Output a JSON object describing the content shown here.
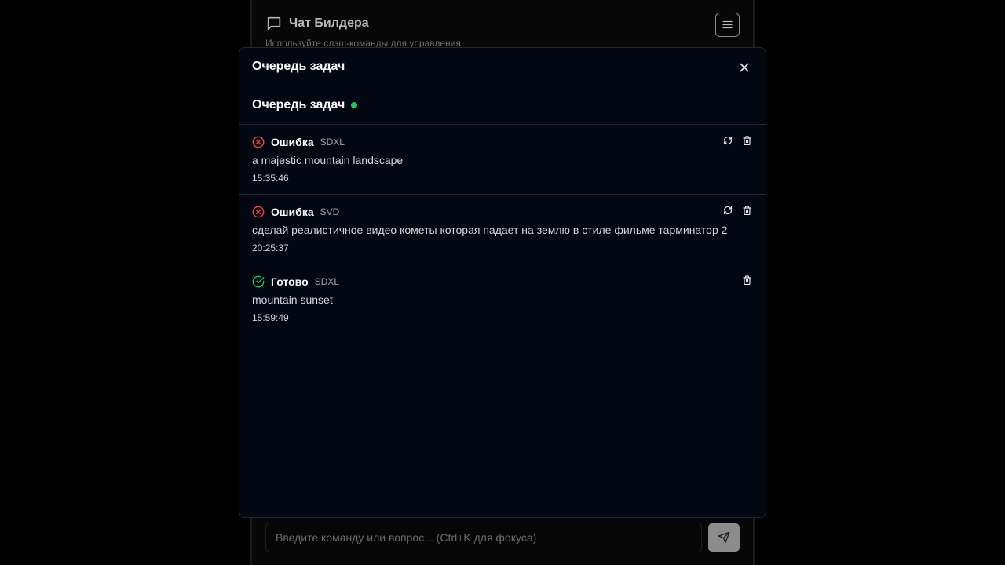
{
  "app": {
    "title": "Чат Билдера",
    "subtitle": "Используйте слэш-команды для управления",
    "composer_placeholder": "Введите команду или вопрос... (Ctrl+K для фокуса)"
  },
  "modal": {
    "title": "Очередь задач",
    "queue_title": "Очередь задач",
    "queue_status_color": "#22c55e",
    "jobs": [
      {
        "status": "Ошибка",
        "status_icon": "x-circle-icon",
        "status_color": "#ef4444",
        "model": "SDXL",
        "prompt": "a majestic mountain landscape",
        "time": "15:35:46",
        "actions": [
          "retry-icon",
          "trash-icon"
        ]
      },
      {
        "status": "Ошибка",
        "status_icon": "x-circle-icon",
        "status_color": "#ef4444",
        "model": "SVD",
        "prompt": "сделай реалистичное видео кометы которая падает на землю в стиле фильме тарминатор 2",
        "time": "20:25:37",
        "actions": [
          "retry-icon",
          "trash-icon"
        ]
      },
      {
        "status": "Готово",
        "status_icon": "check-circle-icon",
        "status_color": "#22c55e",
        "model": "SDXL",
        "prompt": "mountain sunset",
        "time": "15:59:49",
        "actions": [
          "trash-icon"
        ]
      }
    ]
  }
}
